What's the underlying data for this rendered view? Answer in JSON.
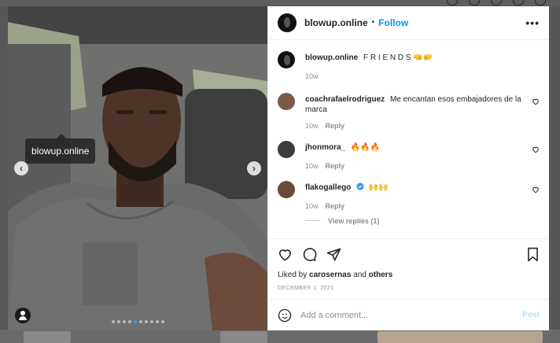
{
  "post": {
    "username": "blowup.online",
    "follow_label": "Follow",
    "separator": "•",
    "more_icon": "more-horizontal-icon",
    "photo_tag": "blowup.online",
    "carousel": {
      "total": 10,
      "active": 4
    }
  },
  "caption": {
    "username": "blowup.online",
    "text": "F R I E N D S 🤜🤛",
    "time": "10w"
  },
  "comments": [
    {
      "username": "coachrafaelrodriguez",
      "text": "Me encantan esos embajadores de la marca",
      "time": "10w",
      "reply_label": "Reply",
      "avatar_color": "#7a5a46"
    },
    {
      "username": "jhonmora_",
      "text": "🔥🔥🔥",
      "time": "10w",
      "reply_label": "Reply",
      "avatar_color": "#3d3d3d"
    },
    {
      "username": "flakogallego",
      "verified": true,
      "text": "🙌🙌",
      "time": "10w",
      "reply_label": "Reply",
      "avatar_color": "#6b4a3a",
      "view_replies": "View replies (1)"
    }
  ],
  "likes": {
    "prefix": "Liked by",
    "user": "carosernas",
    "conj": "and",
    "others": "others"
  },
  "date": "DECEMBER 1, 2021",
  "add_comment": {
    "placeholder": "Add a comment...",
    "post_label": "Post"
  },
  "colors": {
    "accent": "#0095f6",
    "post_disabled": "#b2dffc",
    "verified": "#3897f0"
  }
}
